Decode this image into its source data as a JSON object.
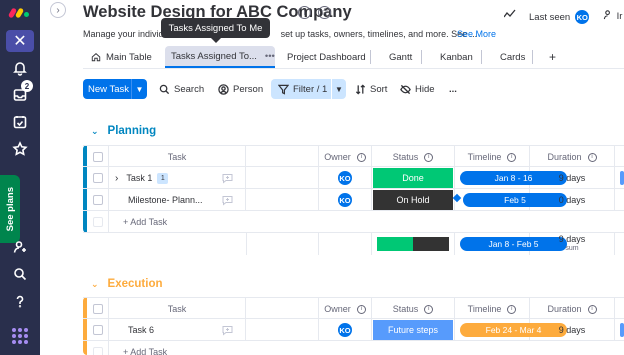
{
  "rail": {
    "notifications_badge": "2",
    "see_plans": "See plans",
    "colors": {
      "background": "#292f4c",
      "see_plans": "#00854d"
    }
  },
  "header": {
    "title": "Website Design for ABC Company",
    "subtitle": "Manage your individu",
    "subtitle_rest": "set up tasks, owners, timelines, and more. See ...",
    "see_more": "See More",
    "tooltip": "Tasks Assigned To Me",
    "last_seen": "Last seen",
    "last_seen_avatar": "KO",
    "invite": "Ir"
  },
  "tabs": [
    {
      "label": "Main Table",
      "icon": "home-icon",
      "active": false
    },
    {
      "label": "Tasks Assigned To...",
      "active": true
    },
    {
      "label": "Project Dashboard",
      "active": false
    },
    {
      "label": "Gantt",
      "active": false
    },
    {
      "label": "Kanban",
      "active": false
    },
    {
      "label": "Cards",
      "active": false
    }
  ],
  "toolbar": {
    "new_task": "New Task",
    "search": "Search",
    "person": "Person",
    "filter": "Filter / 1",
    "sort": "Sort",
    "hide": "Hide",
    "more": "..."
  },
  "columns": {
    "task": "Task",
    "owner": "Owner",
    "status": "Status",
    "timeline": "Timeline",
    "duration": "Duration"
  },
  "groups": [
    {
      "title": "Planning",
      "color": "#0086c0",
      "rows": [
        {
          "task": "Task 1",
          "subitems": "1",
          "owner": "KO",
          "status": "Done",
          "status_color": "#00c875",
          "timeline": "Jan 8 - 16",
          "duration": "9 days"
        },
        {
          "task": "Milestone- Plann...",
          "owner": "KO",
          "status": "On Hold",
          "status_color": "#333333",
          "timeline": "Feb 5",
          "duration": "0 days"
        }
      ],
      "add_task": "+ Add Task",
      "summary": {
        "timeline": "Jan 8 - Feb 5",
        "duration": "9 days",
        "duration_label": "sum",
        "done_share": 0.5
      }
    },
    {
      "title": "Execution",
      "color": "#fdab3d",
      "rows": [
        {
          "task": "Task 6",
          "owner": "KO",
          "status": "Future steps",
          "status_color": "#579bfc",
          "timeline": "Feb 24 - Mar 4",
          "timeline_color": "#fdab3d",
          "duration": "9 days"
        }
      ],
      "add_task": "+ Add Task"
    }
  ]
}
